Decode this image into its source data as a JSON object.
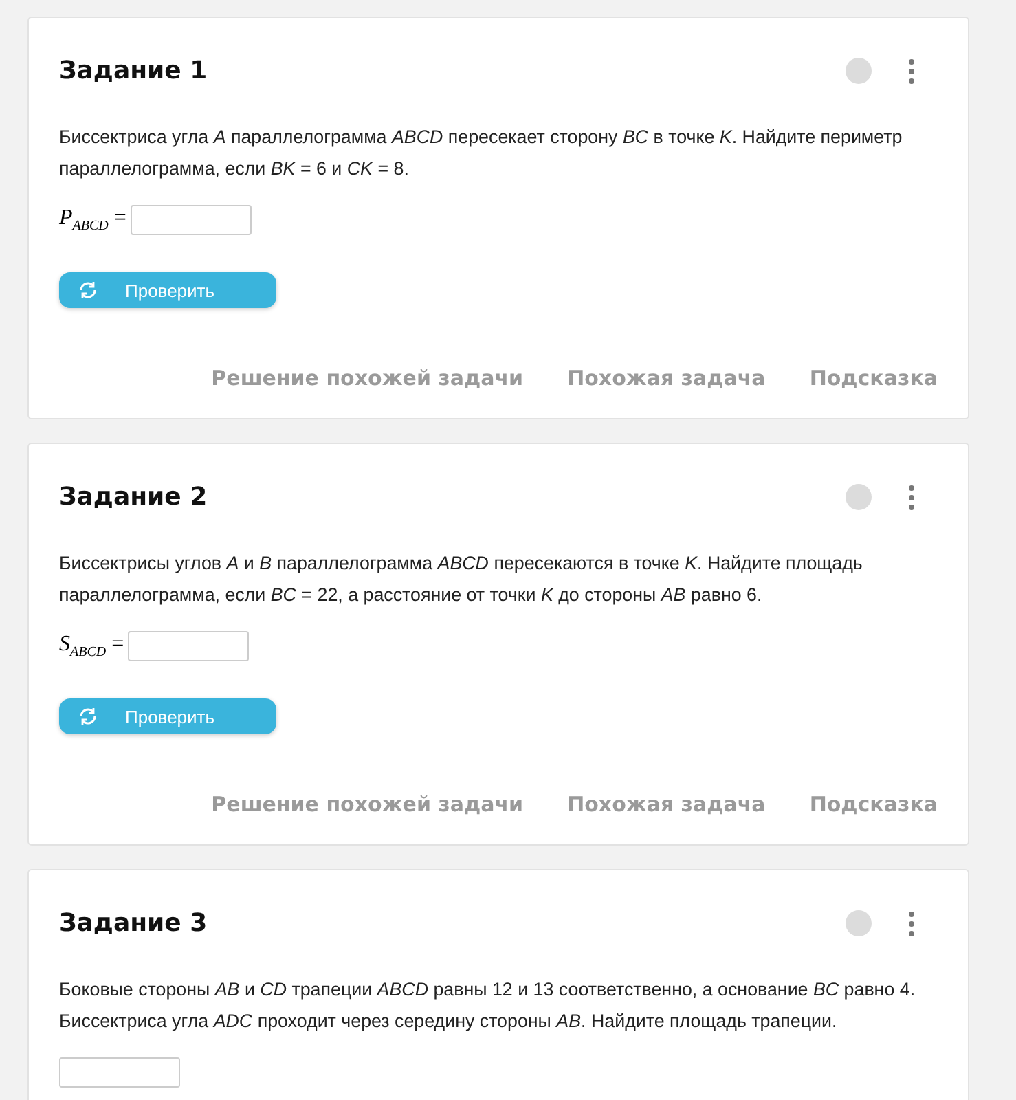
{
  "tasks": [
    {
      "title": "Задание 1",
      "text": "Биссектриса угла *A* параллелограмма *ABCD* пересекает сторону *BC* в точке *K*. Найдите периметр параллелограмма, если *BK* = 6 и *CK* = 8.",
      "answer_label": "*P*$_{ABCD}$ =",
      "button": "Проверить",
      "links": [
        "Решение похожей задачи",
        "Похожая задача",
        "Подсказка"
      ]
    },
    {
      "title": "Задание 2",
      "text": "Биссектрисы углов *A* и *B* параллелограмма *ABCD* пересекаются в точке *K*. Найдите площадь параллелограмма, если *BC* = 22, а расстояние от точки *K* до стороны *AB* равно 6.",
      "answer_label": "*S*$_{ABCD}$ =",
      "button": "Проверить",
      "links": [
        "Решение похожей задачи",
        "Похожая задача",
        "Подсказка"
      ]
    },
    {
      "title": "Задание 3",
      "text": "Боковые стороны *AB* и *CD* трапеции *ABCD* равны 12 и 13 соответственно, а основание *BC* равно 4. Биссектриса угла *ADC* проходит через середину стороны *AB*. Найдите площадь трапеции."
    }
  ]
}
